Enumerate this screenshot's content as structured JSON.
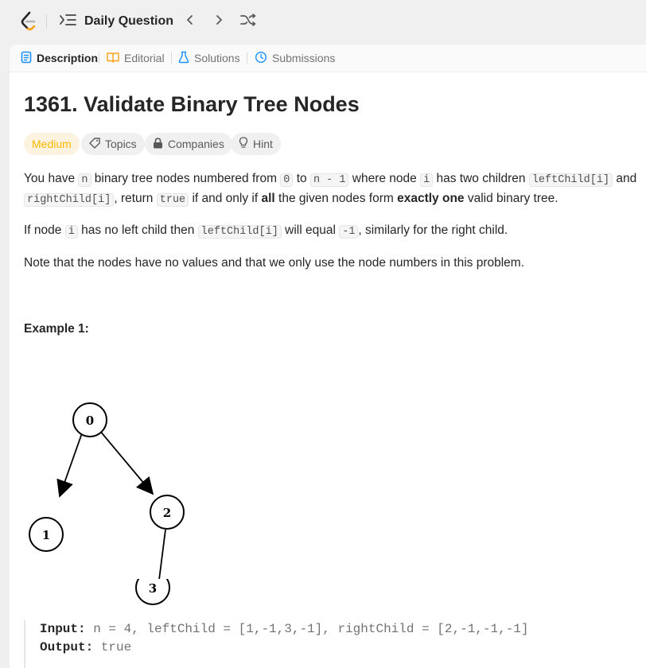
{
  "topbar": {
    "menu_label": "Daily Question",
    "icons": [
      "logo-icon",
      "list-icon",
      "chevron-left-icon",
      "chevron-right-icon",
      "shuffle-icon"
    ]
  },
  "tabs": [
    {
      "label": "Description",
      "icon": "description-icon",
      "active": true
    },
    {
      "label": "Editorial",
      "icon": "book-icon",
      "active": false
    },
    {
      "label": "Solutions",
      "icon": "flask-icon",
      "active": false
    },
    {
      "label": "Submissions",
      "icon": "history-icon",
      "active": false
    }
  ],
  "problem": {
    "title": "1361. Validate Binary Tree Nodes",
    "difficulty": "Medium",
    "pills": [
      "Topics",
      "Companies",
      "Hint"
    ]
  },
  "description": {
    "p1": {
      "t1": "You have ",
      "c1": "n",
      "t2": " binary tree nodes numbered from ",
      "c2": "0",
      "t3": " to ",
      "c3": "n - 1",
      "t4": " where node ",
      "c4": "i",
      "t5": " has two children ",
      "c5": "leftChild[i]",
      "t6": " and ",
      "c6": "rightChild[i]",
      "t7": ", return ",
      "c7": "true",
      "t8": " if and only if ",
      "b1": "all",
      "t9": " the given nodes form ",
      "b2": "exactly one",
      "t10": " valid binary tree."
    },
    "p2": {
      "t1": "If node ",
      "c1": "i",
      "t2": " has no left child then ",
      "c2": "leftChild[i]",
      "t3": " will equal ",
      "c3": "-1",
      "t4": ", similarly for the right child."
    },
    "p3": "Note that the nodes have no values and that we only use the node numbers in this problem."
  },
  "example1": {
    "title": "Example 1:",
    "tree_nodes": [
      "0",
      "1",
      "2",
      "3"
    ],
    "input_label": "Input:",
    "input_value": " n = 4, leftChild = [1,-1,3,-1], rightChild = [2,-1,-1,-1]",
    "output_label": "Output:",
    "output_value": " true"
  },
  "colors": {
    "medium": "#ffb800",
    "tab_active_icon": "#1a90ff",
    "editorial_icon": "#ffa116",
    "solutions_icon": "#1a90ff",
    "submissions_icon": "#1a90ff"
  }
}
